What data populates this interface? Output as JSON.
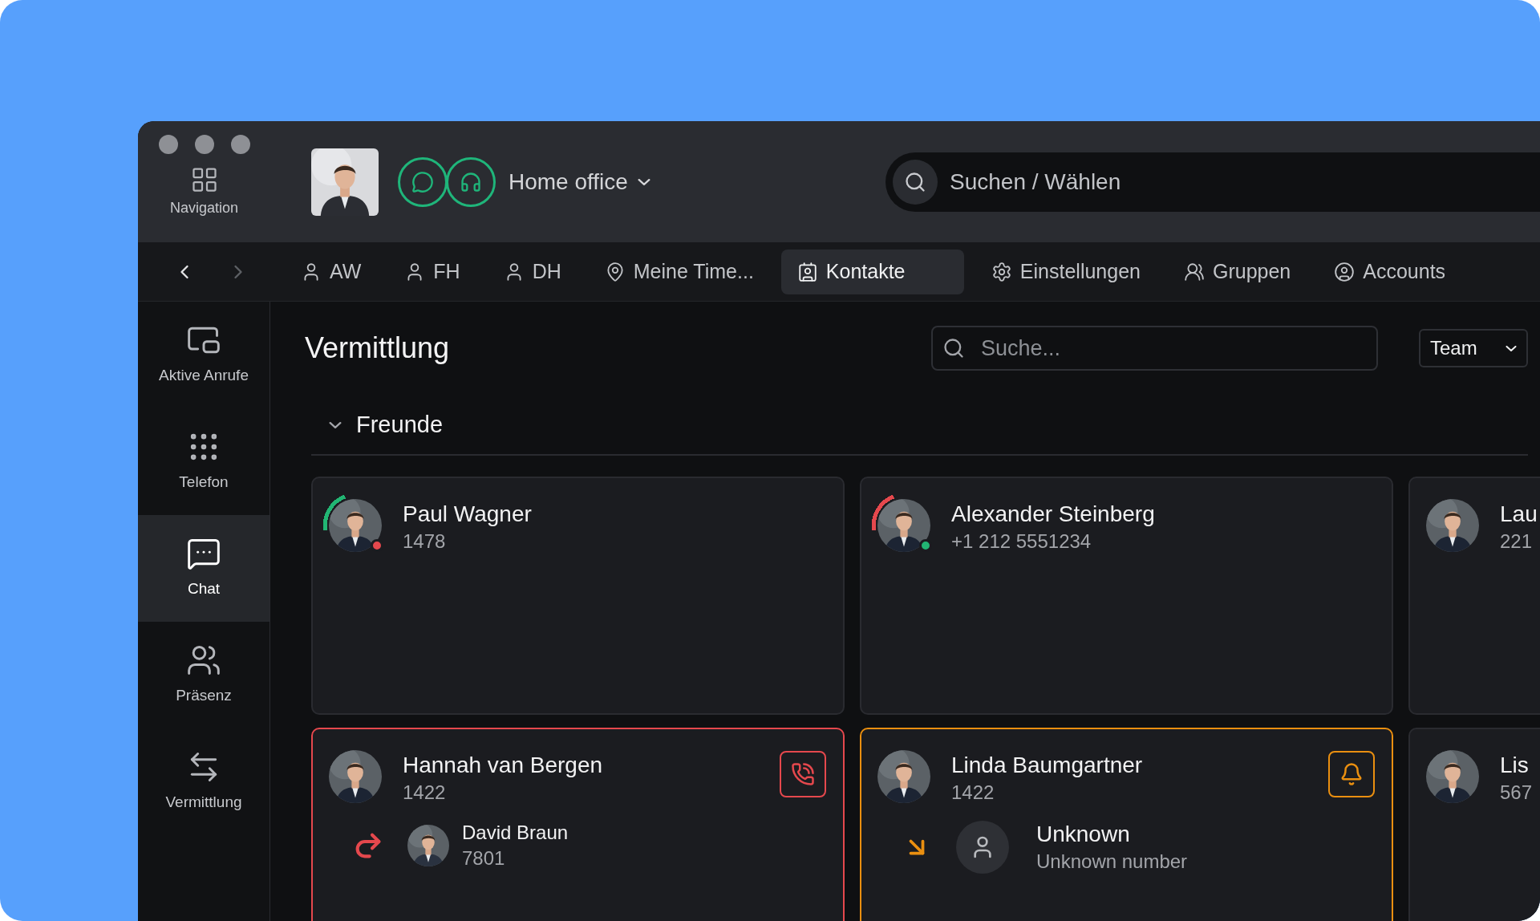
{
  "top_bar": {
    "navigation_label": "Navigation",
    "location": "Home office",
    "search": {
      "placeholder": "Suchen / Wählen"
    }
  },
  "history": {
    "back_disabled": false,
    "forward_disabled": true
  },
  "tabs": [
    {
      "label": "AW",
      "kind": "person",
      "selected": false
    },
    {
      "label": "FH",
      "kind": "person",
      "selected": false
    },
    {
      "label": "DH",
      "kind": "person",
      "selected": false
    },
    {
      "label": "Meine Time...",
      "kind": "pin",
      "selected": false
    },
    {
      "label": "Kontakte",
      "kind": "contacts",
      "selected": true
    },
    {
      "label": "Einstellungen",
      "kind": "settings",
      "selected": false
    },
    {
      "label": "Gruppen",
      "kind": "groups",
      "selected": false
    },
    {
      "label": "Accounts",
      "kind": "account",
      "selected": false
    }
  ],
  "sidebar": {
    "items": [
      {
        "label": "Aktive Anrufe",
        "kind": "active-calls",
        "selected": false
      },
      {
        "label": "Telefon",
        "kind": "keypad",
        "selected": false
      },
      {
        "label": "Chat",
        "kind": "chat",
        "selected": true
      },
      {
        "label": "Präsenz",
        "kind": "presence",
        "selected": false
      },
      {
        "label": "Vermittlung",
        "kind": "transfer",
        "selected": false
      }
    ]
  },
  "content": {
    "title": "Vermittlung",
    "search": {
      "placeholder": "Suche..."
    },
    "filter": "Team",
    "group": {
      "label": "Freunde",
      "expanded": true,
      "contacts": [
        {
          "name": "Paul Wagner",
          "number": "1478",
          "ring": {
            "color": "#22b573"
          },
          "status": {
            "color": "#e5484d"
          }
        },
        {
          "name": "Alexander Steinberg",
          "number": "+1 212 5551234",
          "ring": {
            "color": "#e5484d"
          },
          "status": {
            "color": "#22b573"
          }
        },
        {
          "name": "Lau",
          "number": "221"
        },
        {
          "name": "Hannah van Bergen",
          "number": "1422",
          "alert": {
            "kind": "call"
          },
          "call": {
            "kind": "outgoing",
            "name": "David Braun",
            "number": "7801",
            "has_photo": true
          }
        },
        {
          "name": "Linda Baumgartner",
          "number": "1422",
          "alert": {
            "kind": "bell"
          },
          "call": {
            "kind": "incoming",
            "name": "Unknown",
            "number": "Unknown number",
            "has_photo": false
          }
        },
        {
          "name": "Lis",
          "number": "567"
        }
      ]
    }
  }
}
